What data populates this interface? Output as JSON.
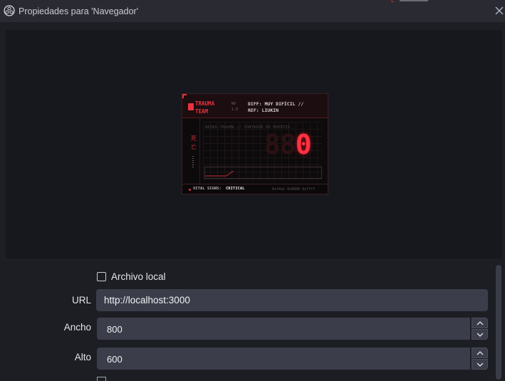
{
  "window": {
    "title": "Propiedades para 'Navegador'",
    "icons": {
      "app": "obs-logo-icon",
      "close": "close-icon"
    }
  },
  "widget": {
    "brand_line1": "TRAUMA",
    "brand_line2": "TEAM",
    "code_line1": "N0",
    "code_line2": "1.0",
    "diff_key": "DIFF:",
    "diff_value": "MUY DIFÍCIL //",
    "ref_key": "REF:",
    "ref_value": "LIUKIN",
    "kanji_1": "死",
    "kanji_2": "亡",
    "subtitle": "NEURO-TRAUMA // CONTADOR DE MUERTES",
    "counter_dim": "88",
    "counter_value": "0",
    "vital_label": "VITAL SIGNS:",
    "vital_value": "CRITICAL",
    "hex": "0xf4a1 0x0000 0xffff",
    "accent_color": "#e8323e"
  },
  "form": {
    "local_file_label": "Archivo local",
    "local_file_checked": false,
    "url_label": "URL",
    "url_value": "http://localhost:3000",
    "width_label": "Ancho",
    "width_value": "800",
    "height_label": "Alto",
    "height_value": "600"
  }
}
